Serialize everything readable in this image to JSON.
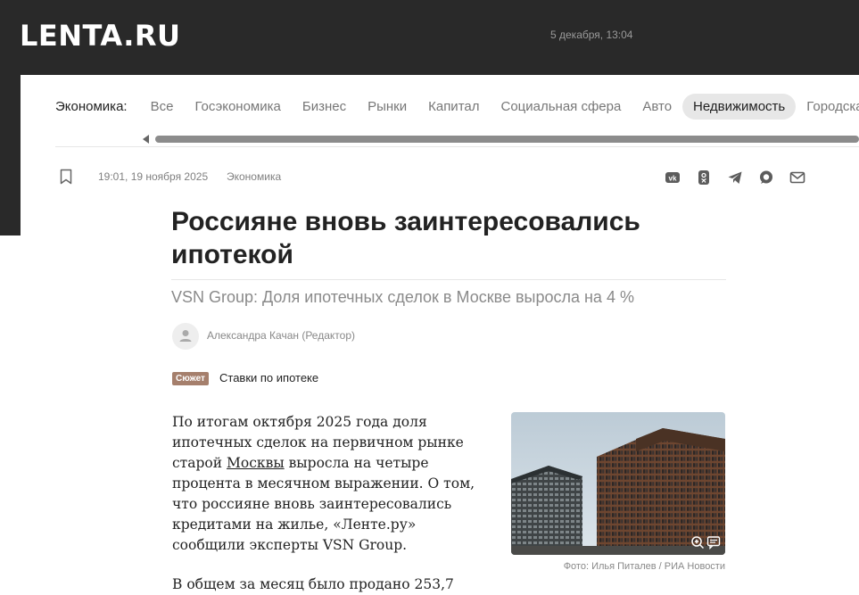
{
  "header": {
    "logo": "LENTA.RU",
    "date": "5 декабря, 13:04"
  },
  "rubrics": {
    "title": "Экономика:",
    "items": [
      "Все",
      "Госэкономика",
      "Бизнес",
      "Рынки",
      "Капитал",
      "Социальная сфера",
      "Авто",
      "Недвижимость",
      "Городская"
    ],
    "active": "Недвижимость"
  },
  "article": {
    "time": "19:01, 19 ноября 2025",
    "rubric": "Экономика",
    "title": "Россияне вновь заинтересовались ипотекой",
    "subtitle": "VSN Group: Доля ипотечных сделок в Москве выросла на 4 %",
    "author": "Александра Качан (Редактор)",
    "badge": "Сюжет",
    "story": "Ставки по ипотеке",
    "p1_before": "По итогам октября 2025 года доля ипотечных сделок на первичном рынке старой ",
    "p1_link": "Москвы",
    "p1_after": " выросла на четыре процента в месячном выражении. О том, что россияне вновь заинтересовались кредитами на жилье, «Ленте.ру» сообщили эксперты VSN Group.",
    "p2": "В общем за месяц было продано 253,7",
    "photo_caption": "Фото: Илья Питалев / РИА Новости"
  },
  "share_icons": [
    "vk-icon",
    "odnoklassniki-icon",
    "telegram-icon",
    "max-icon",
    "mail-icon"
  ],
  "colors": {
    "header_bg": "#292929",
    "badge_bg": "#a57f6c",
    "active_rubric_bg": "#e7e7e7"
  }
}
